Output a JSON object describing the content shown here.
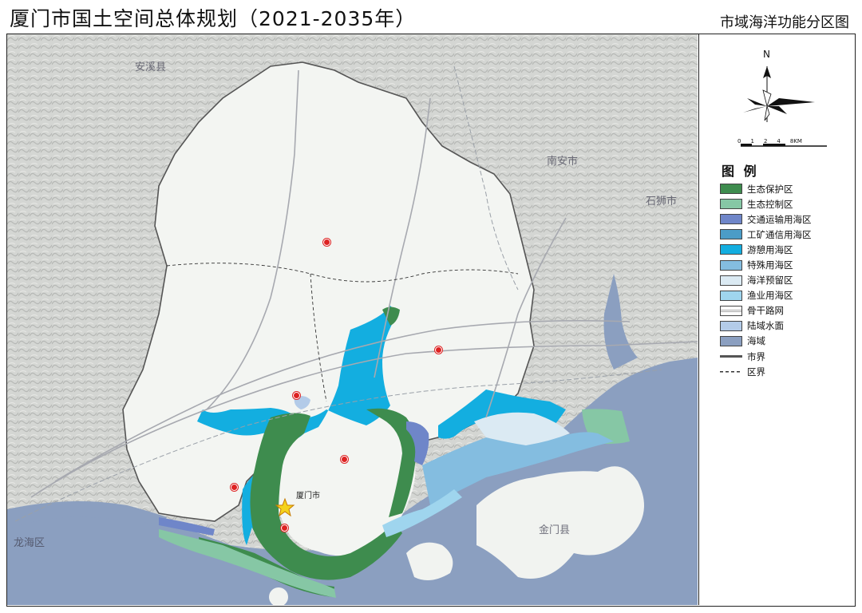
{
  "title": "厦门市国土空间总体规划（2021-2035年）",
  "subtitle": "市域海洋功能分区图",
  "compass": {
    "north": "N"
  },
  "scale_bar": {
    "labels": [
      "0",
      "1",
      "2",
      "4",
      "8KM"
    ]
  },
  "legend": {
    "title": "图 例",
    "items": [
      {
        "label": "生态保护区",
        "color": "#3e8c4e",
        "type": "fill"
      },
      {
        "label": "生态控制区",
        "color": "#86c7a5",
        "type": "fill"
      },
      {
        "label": "交通运输用海区",
        "color": "#6f86c9",
        "type": "fill"
      },
      {
        "label": "工矿通信用海区",
        "color": "#4b9cc7",
        "type": "fill"
      },
      {
        "label": "游憩用海区",
        "color": "#13aee0",
        "type": "fill"
      },
      {
        "label": "特殊用海区",
        "color": "#84bde0",
        "type": "fill"
      },
      {
        "label": "海洋预留区",
        "color": "#dbeaf3",
        "type": "fill"
      },
      {
        "label": "渔业用海区",
        "color": "#9fd5ee",
        "type": "fill"
      },
      {
        "label": "骨干路网",
        "color": "#ffffff",
        "type": "road"
      },
      {
        "label": "陆域水面",
        "color": "#b3cbe8",
        "type": "fill"
      },
      {
        "label": "海域",
        "color": "#8b9fc0",
        "type": "fill"
      },
      {
        "label": "市界",
        "color": "#555555",
        "type": "cityline"
      },
      {
        "label": "区界",
        "color": "#333333",
        "type": "dashline"
      }
    ]
  },
  "map_labels": {
    "xiamen": "厦门市",
    "jinmen": "金门县",
    "longhai": "龙海区",
    "nanan": "安溪县",
    "nanan2": "南安市",
    "shishi": "石狮市"
  },
  "colors": {
    "land": "#f1f3f0",
    "terrain": "#c9cbc8",
    "sea": "#8b9fc0"
  }
}
